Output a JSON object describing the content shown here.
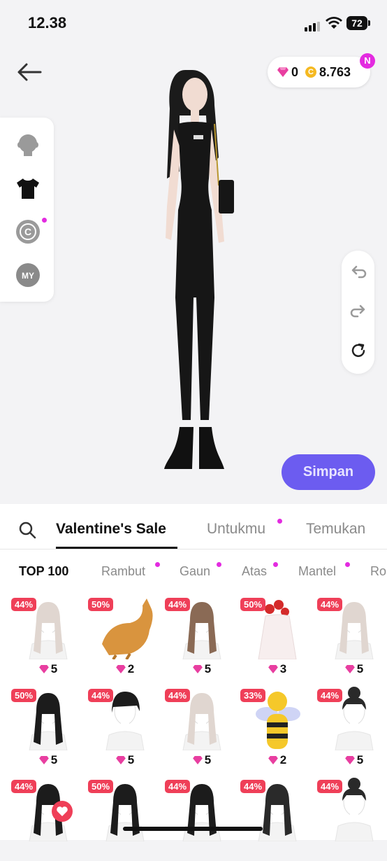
{
  "status_bar": {
    "time": "12.38",
    "battery": "72"
  },
  "currency": {
    "gems": "0",
    "coins": "8.763",
    "coin_symbol": "C",
    "new_badge": "N"
  },
  "left_panel": {
    "items": [
      "avatar-head",
      "tshirt",
      "copyright",
      "MY"
    ]
  },
  "save_button": "Simpan",
  "tabs": [
    {
      "label": "Valentine's Sale",
      "active": true,
      "dot": false
    },
    {
      "label": "Untukmu",
      "active": false,
      "dot": true
    },
    {
      "label": "Temukan",
      "active": false,
      "dot": false
    }
  ],
  "subtabs": [
    {
      "label": "TOP 100",
      "active": true,
      "dot": false
    },
    {
      "label": "Rambut",
      "active": false,
      "dot": true
    },
    {
      "label": "Gaun",
      "active": false,
      "dot": true
    },
    {
      "label": "Atas",
      "active": false,
      "dot": true
    },
    {
      "label": "Mantel",
      "active": false,
      "dot": true
    },
    {
      "label": "Ro",
      "active": false,
      "dot": false
    }
  ],
  "items": [
    {
      "discount": "44%",
      "price": "5",
      "kind": "hair-light"
    },
    {
      "discount": "50%",
      "price": "2",
      "kind": "cat"
    },
    {
      "discount": "44%",
      "price": "5",
      "kind": "hair-brown"
    },
    {
      "discount": "50%",
      "price": "3",
      "kind": "roses-dress"
    },
    {
      "discount": "44%",
      "price": "5",
      "kind": "hair-light"
    },
    {
      "discount": "50%",
      "price": "5",
      "kind": "hair-black"
    },
    {
      "discount": "44%",
      "price": "5",
      "kind": "hair-short-black"
    },
    {
      "discount": "44%",
      "price": "5",
      "kind": "hair-light"
    },
    {
      "discount": "33%",
      "price": "2",
      "kind": "bee"
    },
    {
      "discount": "44%",
      "price": "5",
      "kind": "hair-bun"
    },
    {
      "discount": "44%",
      "price": "",
      "kind": "hair-black"
    },
    {
      "discount": "50%",
      "price": "",
      "kind": "hair-black"
    },
    {
      "discount": "44%",
      "price": "",
      "kind": "hair-black"
    },
    {
      "discount": "44%",
      "price": "",
      "kind": "hair-curly"
    },
    {
      "discount": "44%",
      "price": "",
      "kind": "hair-bun"
    }
  ],
  "colors": {
    "accent": "#6c5cf0",
    "discount": "#ef3f58",
    "gem": "#e83ea0",
    "dot": "#e32be0"
  }
}
